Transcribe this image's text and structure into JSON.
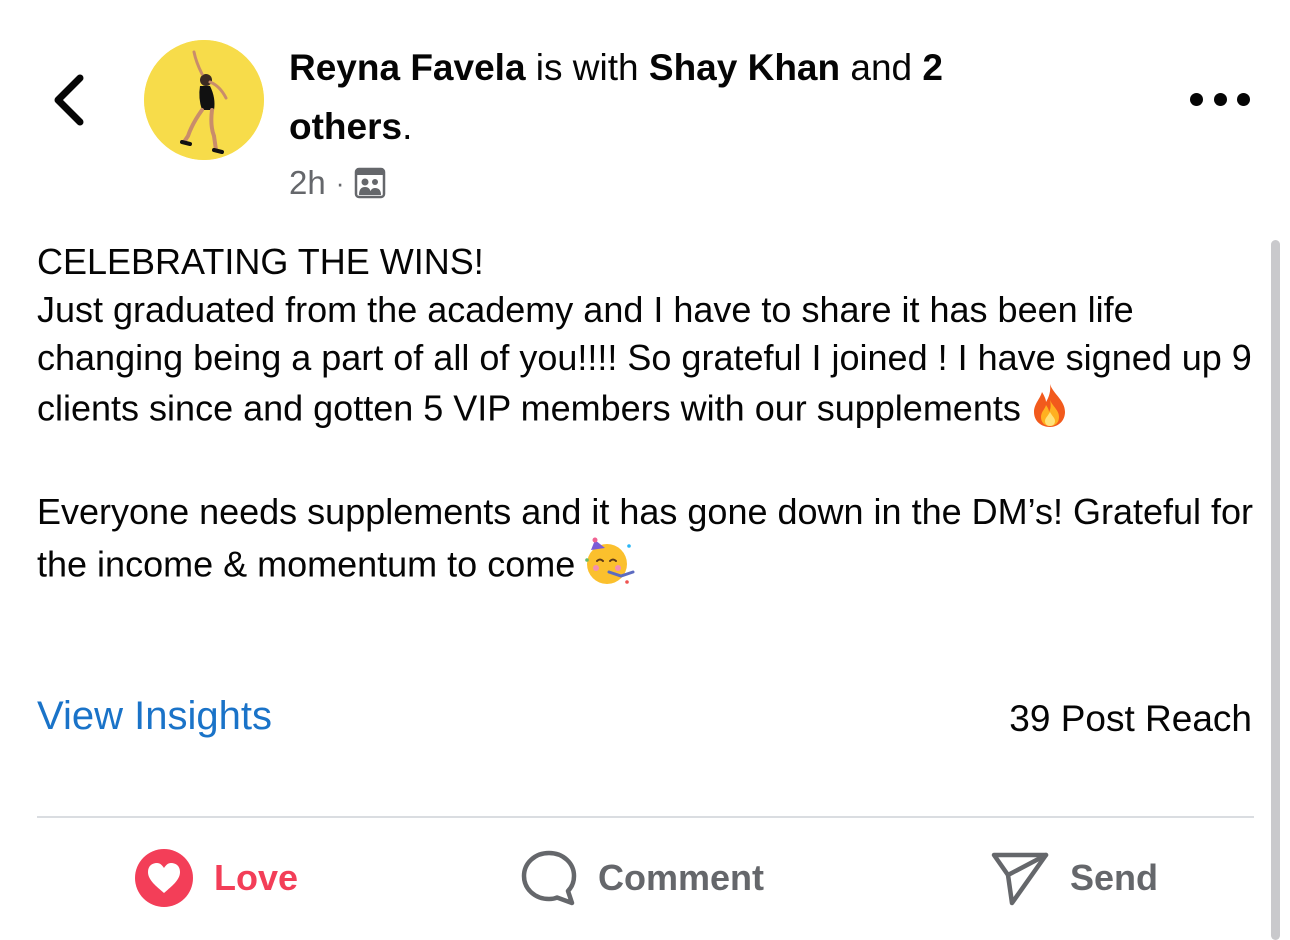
{
  "header": {
    "author": "Reyna Favela",
    "with_text": " is with ",
    "tagged": "Shay Khan",
    "and_text": " and ",
    "others_count": "2",
    "others_label": "others",
    "period": ".",
    "time": "2h",
    "separator": "·",
    "audience_icon": "group-audience-icon",
    "back_icon": "chevron-left-icon",
    "more_icon": "more-dots-icon"
  },
  "post": {
    "line1": "CELEBRATING THE WINS!",
    "paragraph1": "Just graduated from the academy and I have to share it has been life changing being a part of all of you!!!! So grateful I joined ! I have signed up 9 clients since and gotten 5 VIP members with our supplements",
    "emoji1": "fire-emoji",
    "paragraph2": "Everyone needs supplements and it has gone down in the DM’s! Grateful for the income & momentum to come",
    "emoji2": "partying-face-emoji"
  },
  "insights": {
    "link_label": "View Insights",
    "reach": "39 Post Reach"
  },
  "actions": {
    "love": "Love",
    "comment": "Comment",
    "send": "Send"
  },
  "colors": {
    "link": "#1a73c8",
    "love": "#f33e58",
    "muted": "#65676b",
    "avatar_bg": "#f7dc4a"
  }
}
